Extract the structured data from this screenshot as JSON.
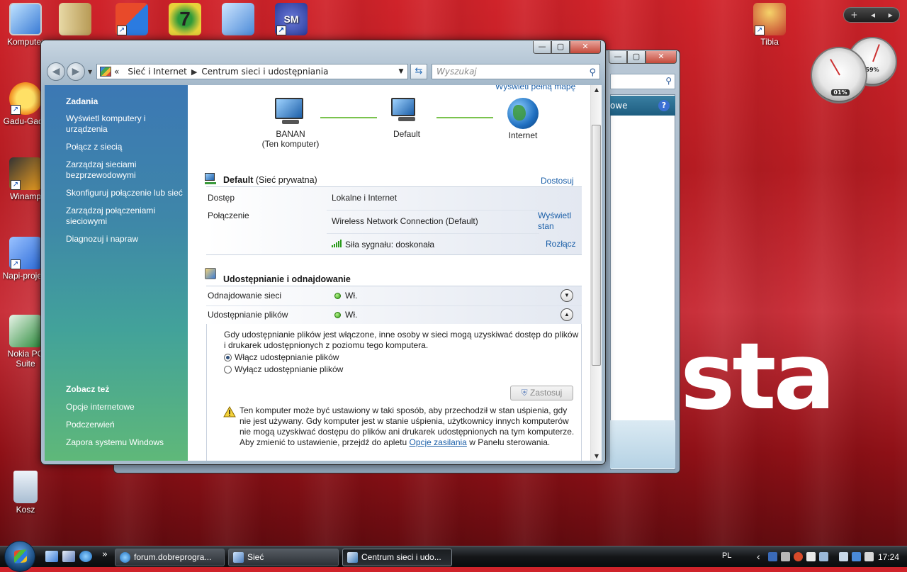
{
  "desktop": {
    "icons": [
      {
        "label": "Komputer",
        "color": "#3a7bd5"
      },
      {
        "label": "",
        "color": "#d6c28a"
      },
      {
        "label": "",
        "color": "#e84a2a"
      },
      {
        "label": "",
        "color": "#2f9a3a"
      },
      {
        "label": "",
        "color": "#4a8ad8"
      },
      {
        "label": "",
        "color": "#2a3a9a"
      },
      {
        "label": "Tibia",
        "color": "#e0b020"
      },
      {
        "label": "Gadu-Gadu",
        "color": "#f4c21e"
      },
      {
        "label": "Winamp",
        "color": "#f0a020"
      },
      {
        "label": "Napi-projekt",
        "color": "#2a6ad8"
      },
      {
        "label": "Nokia PC Suite",
        "color": "#2a8a3a"
      },
      {
        "label": "Kosz",
        "color": "#c8d8e8"
      }
    ],
    "wallpaper_text": "sta",
    "gadgets": {
      "cpu": "01%",
      "mem": "59%"
    }
  },
  "back_window": {
    "bar_text": "owe",
    "help": "?"
  },
  "window": {
    "caption_buttons": {
      "minimize": "—",
      "maximize": "▢",
      "close": "✕"
    },
    "nav": {
      "back": "◀",
      "forward": "▶",
      "dropdown": "▼"
    },
    "address": {
      "prefix": "«",
      "crumb1": "Sieć i Internet",
      "crumb2": "Centrum sieci i udostępniania",
      "sep": "▶",
      "dropdown": "▼"
    },
    "refresh": "⇆",
    "search_placeholder": "Wyszukaj",
    "search_icon": "⚲",
    "left_pane": {
      "tasks_title": "Zadania",
      "tasks": [
        "Wyświetl komputery i urządzenia",
        "Połącz z siecią",
        "Zarządzaj sieciami bezprzewodowymi",
        "Skonfiguruj połączenie lub sieć",
        "Zarządzaj połączeniami sieciowymi",
        "Diagnozuj i napraw"
      ],
      "see_also_title": "Zobacz też",
      "see_also": [
        "Opcje internetowe",
        "Podczerwień",
        "Zapora systemu Windows"
      ]
    },
    "content": {
      "full_map_link": "Wyświetl pełną mapę",
      "map": {
        "node1_name": "BANAN",
        "node1_sub": "(Ten komputer)",
        "node2_name": "Default",
        "node3_name": "Internet"
      },
      "network": {
        "name": "Default",
        "type": "(Sieć prywatna)",
        "customize": "Dostosuj",
        "access_label": "Dostęp",
        "access_value": "Lokalne i Internet",
        "connection_label": "Połączenie",
        "connection_value": "Wireless Network Connection (Default)",
        "view_status": "Wyświetl stan",
        "signal": "Siła sygnału: doskonała",
        "disconnect": "Rozłącz"
      },
      "sharing": {
        "title": "Udostępnianie i odnajdowanie",
        "discovery_label": "Odnajdowanie sieci",
        "discovery_value": "Wł.",
        "file_label": "Udostępnianie plików",
        "file_value": "Wł.",
        "expand_down": "▼",
        "expand_up": "▲",
        "description_line1": "Gdy udostępnianie plików jest włączone, inne osoby w sieci mogą uzyskiwać dostęp do plików",
        "description_line2": "i drukarek udostępnionych z poziomu tego komputera.",
        "option_on": "Włącz udostępnianie plików",
        "option_off": "Wyłącz udostępnianie plików",
        "selected_option": "option_on",
        "apply": "Zastosuj",
        "warning_line1": "Ten komputer może być ustawiony w taki sposób, aby przechodził w stan uśpienia, gdy",
        "warning_line2": "nie jest używany. Gdy komputer jest w stanie uśpienia, użytkownicy innych komputerów",
        "warning_line3": "nie mogą uzyskiwać dostępu do plików ani drukarek udostępnionych na tym komputerze.",
        "warning_line4_pre": "Aby zmienić to ustawienie, przejdź do apletu",
        "warning_link": "Opcje zasilania",
        "warning_line4_post": "w Panelu sterowania."
      }
    }
  },
  "taskbar": {
    "more": "»",
    "tasks": [
      {
        "label": "forum.dobreprogra...",
        "color": "#3a8ad8"
      },
      {
        "label": "Sieć",
        "color": "#4a7ab8"
      },
      {
        "label": "Centrum sieci i udo...",
        "color": "#3a7ab8"
      }
    ],
    "lang": "PL",
    "clock": "17:24",
    "tray_arrow": "‹"
  },
  "sidebar_controls": {
    "add": "+",
    "prev": "◂",
    "next": "▸"
  },
  "colors": {
    "accent": "#1b5fa8",
    "left_pane_top": "#3c78b4",
    "left_pane_bottom": "#5fb879",
    "status_green": "#2e9a16"
  }
}
